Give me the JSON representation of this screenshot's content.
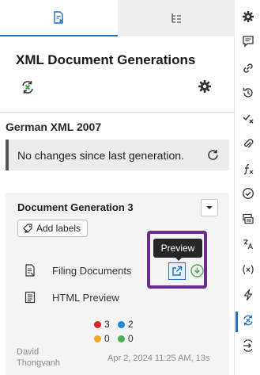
{
  "tabs": [
    {
      "icon": "document-x-icon",
      "active": true
    },
    {
      "icon": "list-tree-icon",
      "active": false
    }
  ],
  "panel": {
    "title": "XML Document Generations"
  },
  "section": {
    "title": "German XML 2007",
    "notice": "No changes since last generation."
  },
  "card": {
    "title": "Document Generation 3",
    "add_labels": "Add labels",
    "rows": [
      {
        "label": "Filing Documents",
        "icon": "filing-document-icon"
      },
      {
        "label": "HTML Preview",
        "icon": "html-document-icon"
      }
    ],
    "tooltip": "Preview",
    "counts": {
      "red": "3",
      "blue": "2",
      "orange": "0",
      "green": "0"
    },
    "user": "David Thongvanh",
    "date": "Apr 2, 2024 11:25 AM, 13s"
  },
  "colors": {
    "accent": "#1a73c9",
    "highlight": "#6b2c91",
    "red": "#e02424",
    "blue": "#1e88e5",
    "orange": "#f5a623",
    "green": "#4caf50"
  },
  "right_rail": [
    "gear-icon",
    "comment-icon",
    "link-icon",
    "history-icon",
    "check-x-icon",
    "paperclip-icon",
    "function-icon",
    "check-circle-icon",
    "stack-icon",
    "translate-icon",
    "variable-icon",
    "lightning-icon",
    "sync-x-icon",
    "sign-in-icon"
  ]
}
